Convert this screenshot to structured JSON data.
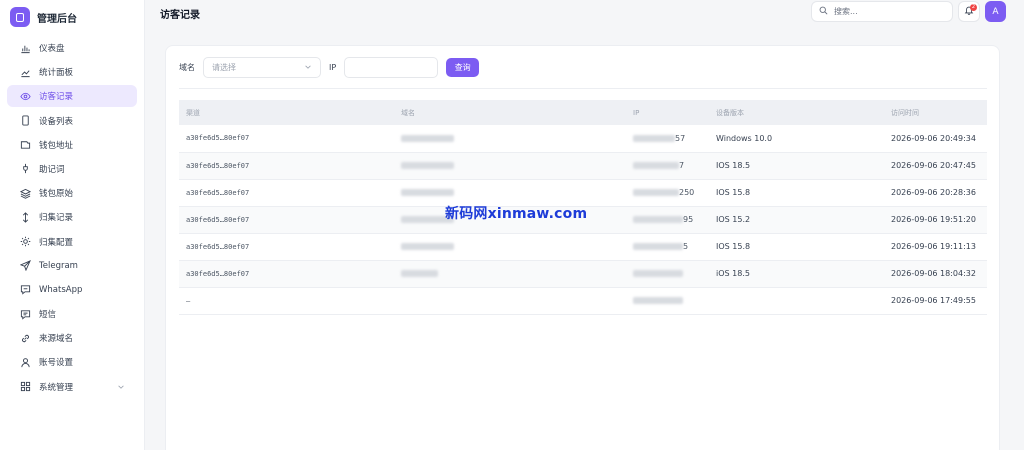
{
  "brand": {
    "name": "管理后台"
  },
  "sidebar": {
    "items": [
      {
        "label": "仪表盘",
        "icon": "bar-chart-icon"
      },
      {
        "label": "统计面板",
        "icon": "line-chart-icon"
      },
      {
        "label": "访客记录",
        "icon": "eye-icon",
        "active": true
      },
      {
        "label": "设备列表",
        "icon": "phone-icon"
      },
      {
        "label": "钱包地址",
        "icon": "wallet-icon"
      },
      {
        "label": "助记词",
        "icon": "key-icon"
      },
      {
        "label": "钱包原始",
        "icon": "layers-icon"
      },
      {
        "label": "归集记录",
        "icon": "arrows-updown-icon"
      },
      {
        "label": "归集配置",
        "icon": "sun-icon"
      },
      {
        "label": "Telegram",
        "icon": "send-icon"
      },
      {
        "label": "WhatsApp",
        "icon": "chat-icon"
      },
      {
        "label": "短信",
        "icon": "message-icon"
      },
      {
        "label": "来源域名",
        "icon": "link-icon"
      },
      {
        "label": "账号设置",
        "icon": "user-icon"
      },
      {
        "label": "系统管理",
        "icon": "grid-icon",
        "expandable": true
      }
    ]
  },
  "header": {
    "title": "访客记录",
    "search_placeholder": "搜索...",
    "notification_count": "2",
    "avatar_letter": "A"
  },
  "filter": {
    "domain_label": "域名",
    "domain_placeholder": "请选择",
    "ip_label": "IP",
    "ip_value": "",
    "query_button": "查询"
  },
  "table": {
    "columns": [
      "渠道",
      "域名",
      "IP",
      "设备版本",
      "访问时间"
    ],
    "rows": [
      {
        "channel": "a30fe6d5…80ef07",
        "ip_tail": "57",
        "device": "Windows 10.0",
        "time": "2026-09-06 20:49:34"
      },
      {
        "channel": "a30fe6d5…80ef07",
        "ip_tail": "7",
        "device": "IOS 18.5",
        "time": "2026-09-06 20:47:45"
      },
      {
        "channel": "a30fe6d5…80ef07",
        "ip_tail": "250",
        "device": "IOS 15.8",
        "time": "2026-09-06 20:28:36"
      },
      {
        "channel": "a30fe6d5…80ef07",
        "ip_tail": "95",
        "device": "IOS 15.2",
        "time": "2026-09-06 19:51:20"
      },
      {
        "channel": "a30fe6d5…80ef07",
        "ip_tail": "5",
        "device": "IOS 15.8",
        "time": "2026-09-06 19:11:13"
      },
      {
        "channel": "a30fe6d5…80ef07",
        "ip_tail": "",
        "device": "iOS 18.5",
        "time": "2026-09-06 18:04:32"
      },
      {
        "channel": "–",
        "ip_tail": "",
        "device": "",
        "time": "2026-09-06 17:49:55"
      }
    ]
  },
  "watermark": "新码网xinmaw.com",
  "colors": {
    "accent": "#7c5cf2",
    "active_bg": "#ede9fe",
    "badge": "#ef4444"
  }
}
